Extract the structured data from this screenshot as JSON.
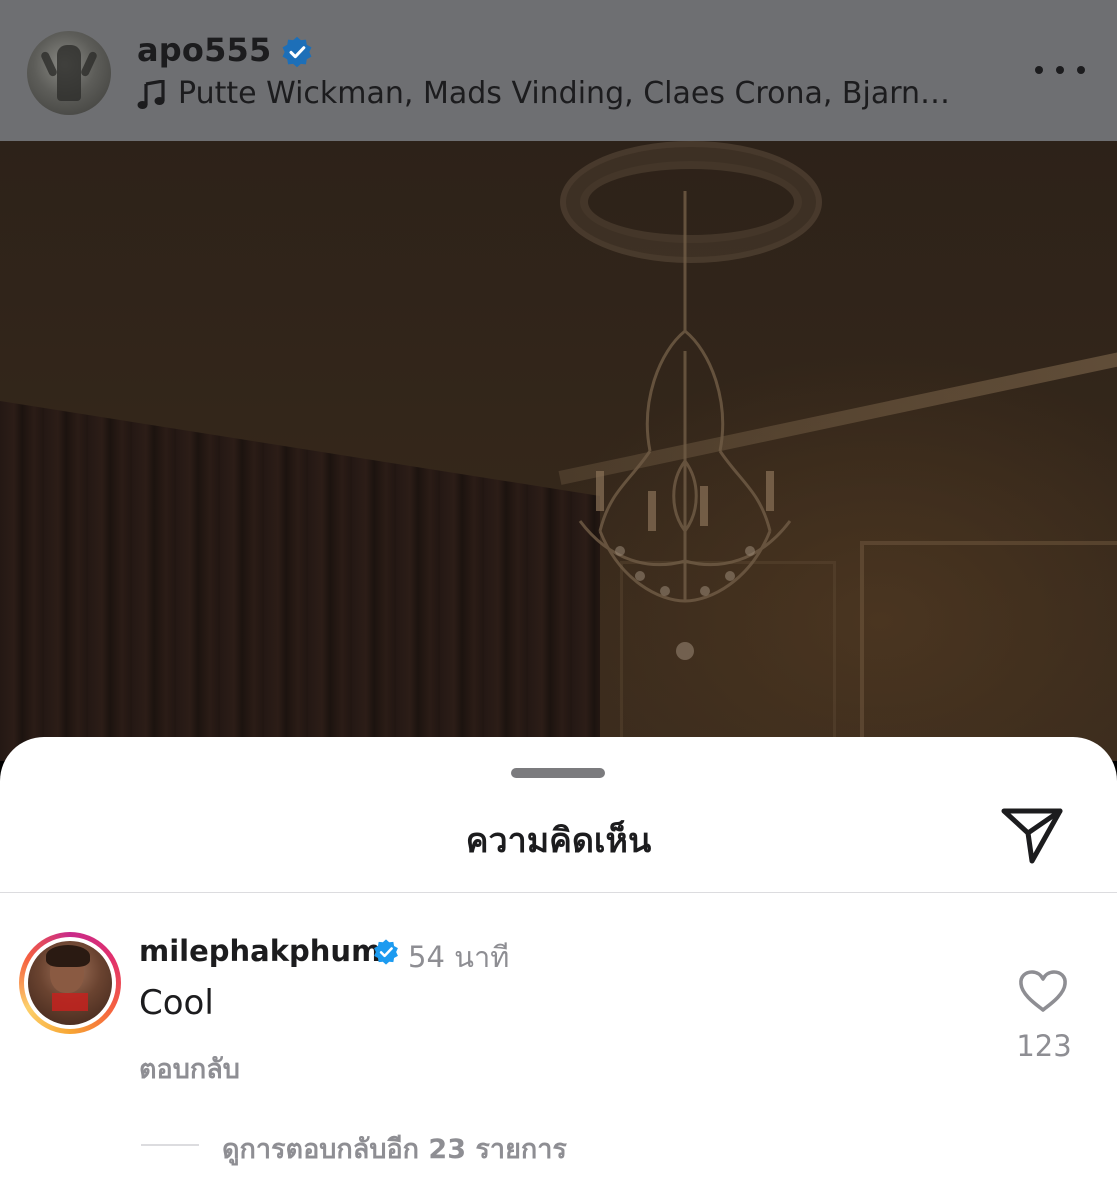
{
  "post_header": {
    "username": "apo555",
    "music_text": "Putte Wickman, Mads Vinding, Claes Crona, Bjarne…",
    "avatar_icon": "statue-avatar",
    "verified_icon": "verified-badge-icon",
    "music_icon": "music-note-icon",
    "more_icon": "more-options-icon"
  },
  "photo": {
    "description_icon": "chandelier-photo"
  },
  "comments_sheet": {
    "title": "ความคิดเห็น",
    "share_icon": "send-icon",
    "comments": [
      {
        "username": "milephakphum",
        "verified": true,
        "time": "54 นาที",
        "text": "Cool",
        "reply_label": "ตอบกลับ",
        "like_count": "123",
        "view_replies_label": "ดูการตอบกลับอีก 23 รายการ"
      }
    ]
  },
  "colors": {
    "verified_blue": "#1d9bf0",
    "header_bg_dimmed": "#6e6f72",
    "secondary_text": "#8e8e93",
    "story_ring_start": "#c82a8a",
    "story_ring_end": "#fcd06b"
  }
}
